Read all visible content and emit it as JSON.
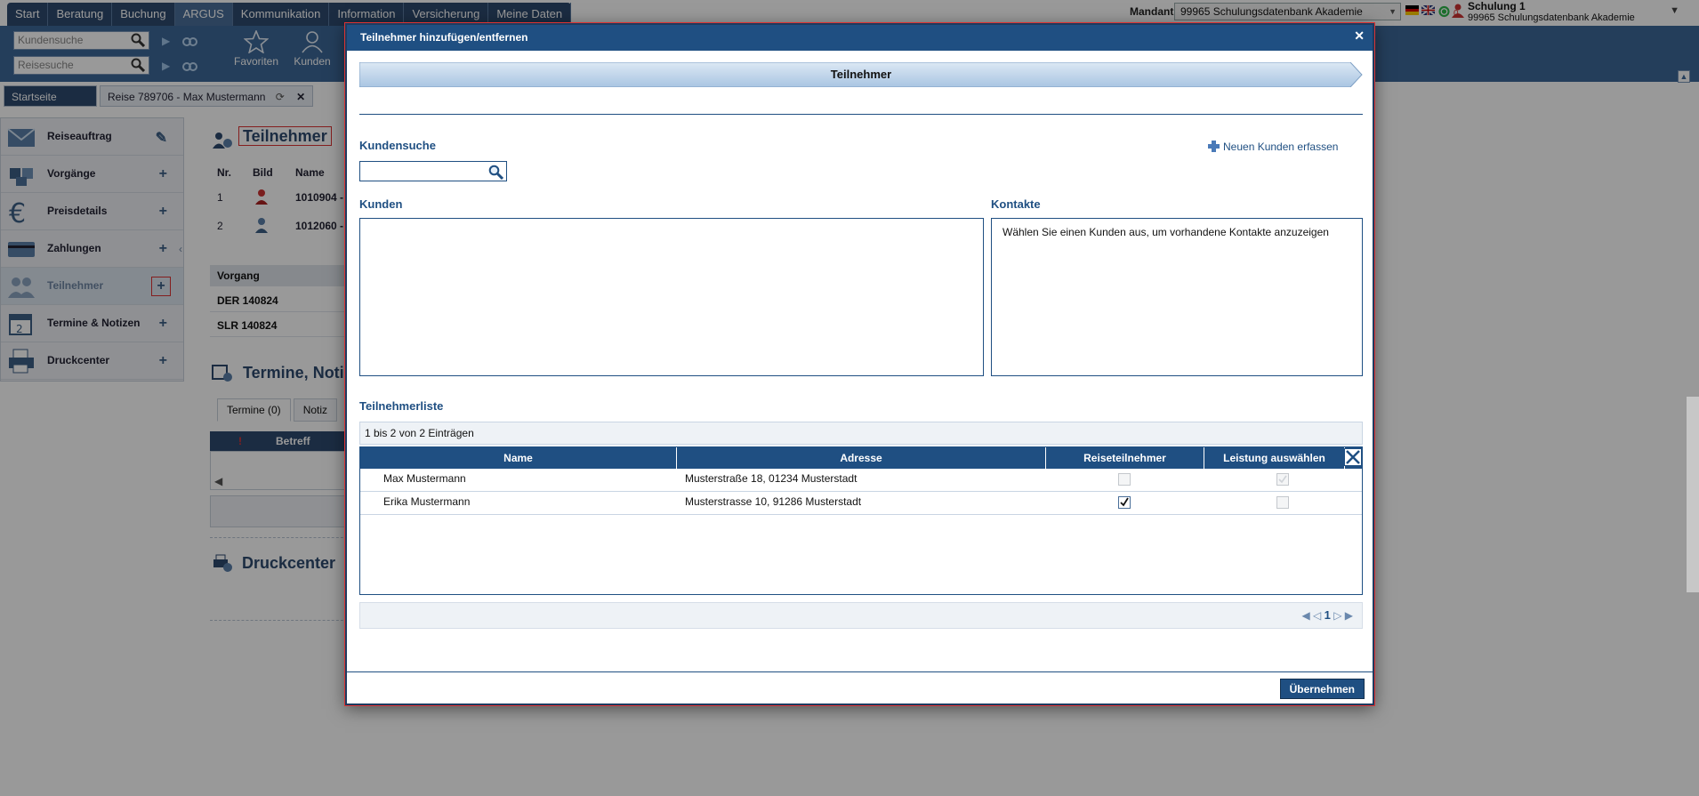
{
  "topnav": {
    "tabs": [
      "Start",
      "Beratung",
      "Buchung",
      "ARGUS",
      "Kommunikation",
      "Information",
      "Versicherung",
      "Meine Daten"
    ],
    "active_tab": "ARGUS"
  },
  "header": {
    "mandant_label": "Mandant",
    "mandant_value": "99965 Schulungsdatenbank Akademie",
    "notification_count": "0",
    "user_name": "Schulung 1",
    "user_org": "99965 Schulungsdatenbank Akademie"
  },
  "toolbar": {
    "kundensuche_placeholder": "Kundensuche",
    "reisesuche_placeholder": "Reisesuche",
    "buttons": [
      "Favoriten",
      "Kunden"
    ]
  },
  "doctabs": {
    "home": "Startseite",
    "reise": "Reise 789706 - Max Mustermann"
  },
  "sidebar": {
    "items": [
      {
        "label": "Reiseauftrag",
        "icon": "pencil-icon"
      },
      {
        "label": "Vorgänge",
        "icon": "plus-icon"
      },
      {
        "label": "Preisdetails",
        "icon": "plus-icon"
      },
      {
        "label": "Zahlungen",
        "icon": "plus-icon"
      },
      {
        "label": "Teilnehmer",
        "icon": "plus-icon"
      },
      {
        "label": "Termine & Notizen",
        "icon": "plus-icon"
      },
      {
        "label": "Druckcenter",
        "icon": "plus-icon"
      }
    ]
  },
  "background": {
    "teilnehmer_title": "Teilnehmer",
    "table_headers": [
      "Nr.",
      "Bild",
      "Name"
    ],
    "rows": [
      {
        "nr": "1",
        "name": "1010904 -"
      },
      {
        "nr": "2",
        "name": "1012060 -"
      }
    ],
    "vorgang_header": "Vorgang",
    "vorgang_rows": [
      "DER 140824",
      "SLR 140824"
    ],
    "termine_title": "Termine, Notiz",
    "termine_tabs": [
      "Termine (0)",
      "Notiz"
    ],
    "grid_header": "Betreff",
    "druckcenter_title": "Druckcenter"
  },
  "modal": {
    "title": "Teilnehmer hinzufügen/entfernen",
    "step_label": "Teilnehmer",
    "kundensuche_label": "Kundensuche",
    "kundensuche_value": "",
    "new_customer_link": "Neuen Kunden erfassen",
    "kunden_label": "Kunden",
    "kontakte_label": "Kontakte",
    "kontakte_hint": "Wählen Sie einen Kunden aus, um vorhandene Kontakte anzuzeigen",
    "list_label": "Teilnehmerliste",
    "entries_info": "1 bis 2 von 2 Einträgen",
    "columns": [
      "Name",
      "Adresse",
      "Reiseteilnehmer",
      "Leistung auswählen"
    ],
    "rows": [
      {
        "name": "Max Mustermann",
        "address": "Musterstraße 18, 01234 Musterstadt",
        "reiseteilnehmer": false,
        "leistung": true
      },
      {
        "name": "Erika Mustermann",
        "address": "Musterstrasse 10, 91286 Musterstadt",
        "reiseteilnehmer": true,
        "leistung": false
      }
    ],
    "page": "1",
    "apply_label": "Übernehmen"
  },
  "colors": {
    "primary": "#1f4f82",
    "nav": "#2d4a6e",
    "accent_red": "#dd3333"
  }
}
